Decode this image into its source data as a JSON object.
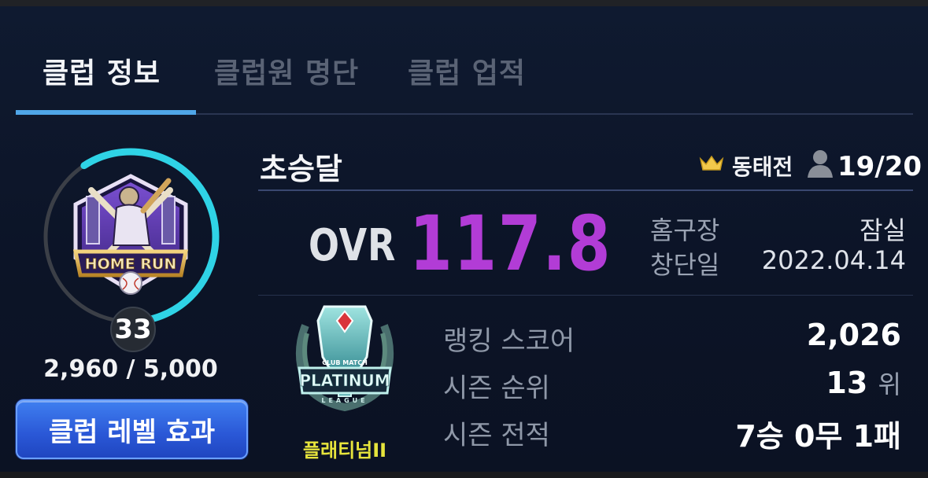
{
  "tabs": [
    {
      "label": "클럽 정보",
      "active": true
    },
    {
      "label": "클럽원 명단",
      "active": false
    },
    {
      "label": "클럽 업적",
      "active": false
    }
  ],
  "colors": {
    "accent_blue": "#4fa6e8",
    "ovr_purple": "#b23cd6",
    "tier_yellow": "#e6e43c",
    "progress_cyan": "#2fd3e6",
    "button_blue": "#2a57d6"
  },
  "club": {
    "emblem_text": "HOME RUN",
    "level": "33",
    "exp": {
      "current": 2960,
      "max": 5000,
      "text": "2,960 / 5,000"
    },
    "level_button": "클럽 레벨 효과",
    "name": "초승달",
    "leader": {
      "icon": "crown-icon",
      "name": "동태전"
    },
    "members": {
      "icon": "person-icon",
      "text": "19/20"
    },
    "ovr": {
      "label": "OVR",
      "value": "117.8"
    },
    "home_stadium": {
      "label": "홈구장",
      "value": "잠실"
    },
    "founded": {
      "label": "창단일",
      "value": "2022.04.14"
    }
  },
  "tier": {
    "emblem_subtitle": "CLUB MATCH",
    "emblem_text": "PLATINUM",
    "emblem_league": "LEAGUE",
    "name": "플래티넘II"
  },
  "stats": {
    "ranking_score": {
      "label": "랭킹 스코어",
      "value": "2,026"
    },
    "season_rank": {
      "label": "시즌 순위",
      "value": "13",
      "unit": "위"
    },
    "season_record": {
      "label": "시즌 전적",
      "value": "7승 0무 1패"
    }
  }
}
